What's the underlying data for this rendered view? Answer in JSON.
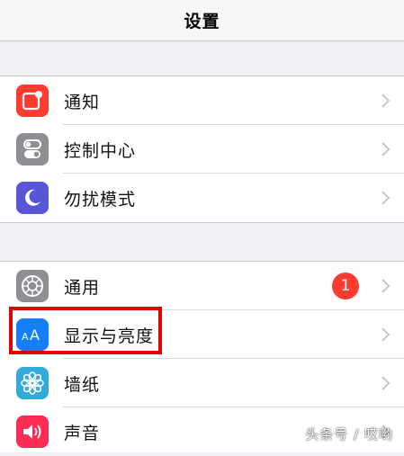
{
  "header": {
    "title": "设置"
  },
  "groups": [
    {
      "items": [
        {
          "label": "通知",
          "icon": "notifications-icon",
          "icon_color": "#ff3b30"
        },
        {
          "label": "控制中心",
          "icon": "control-center-icon",
          "icon_color": "#8e8e93"
        },
        {
          "label": "勿扰模式",
          "icon": "moon-icon",
          "icon_color": "#5856d6"
        }
      ]
    },
    {
      "items": [
        {
          "label": "通用",
          "icon": "gear-icon",
          "icon_color": "#8e8e93",
          "badge": "1"
        },
        {
          "label": "显示与亮度",
          "icon": "display-brightness-icon",
          "icon_color": "#147efb",
          "icon_text": "AA"
        },
        {
          "label": "墙纸",
          "icon": "flower-icon",
          "icon_color": "#34aadc"
        },
        {
          "label": "声音",
          "icon": "speaker-icon",
          "icon_color": "#ff2d55"
        }
      ]
    }
  ],
  "colors": {
    "badge": "#ff3b30",
    "highlight_box": "#e00000"
  },
  "watermark": "头条号 / 哎哟"
}
